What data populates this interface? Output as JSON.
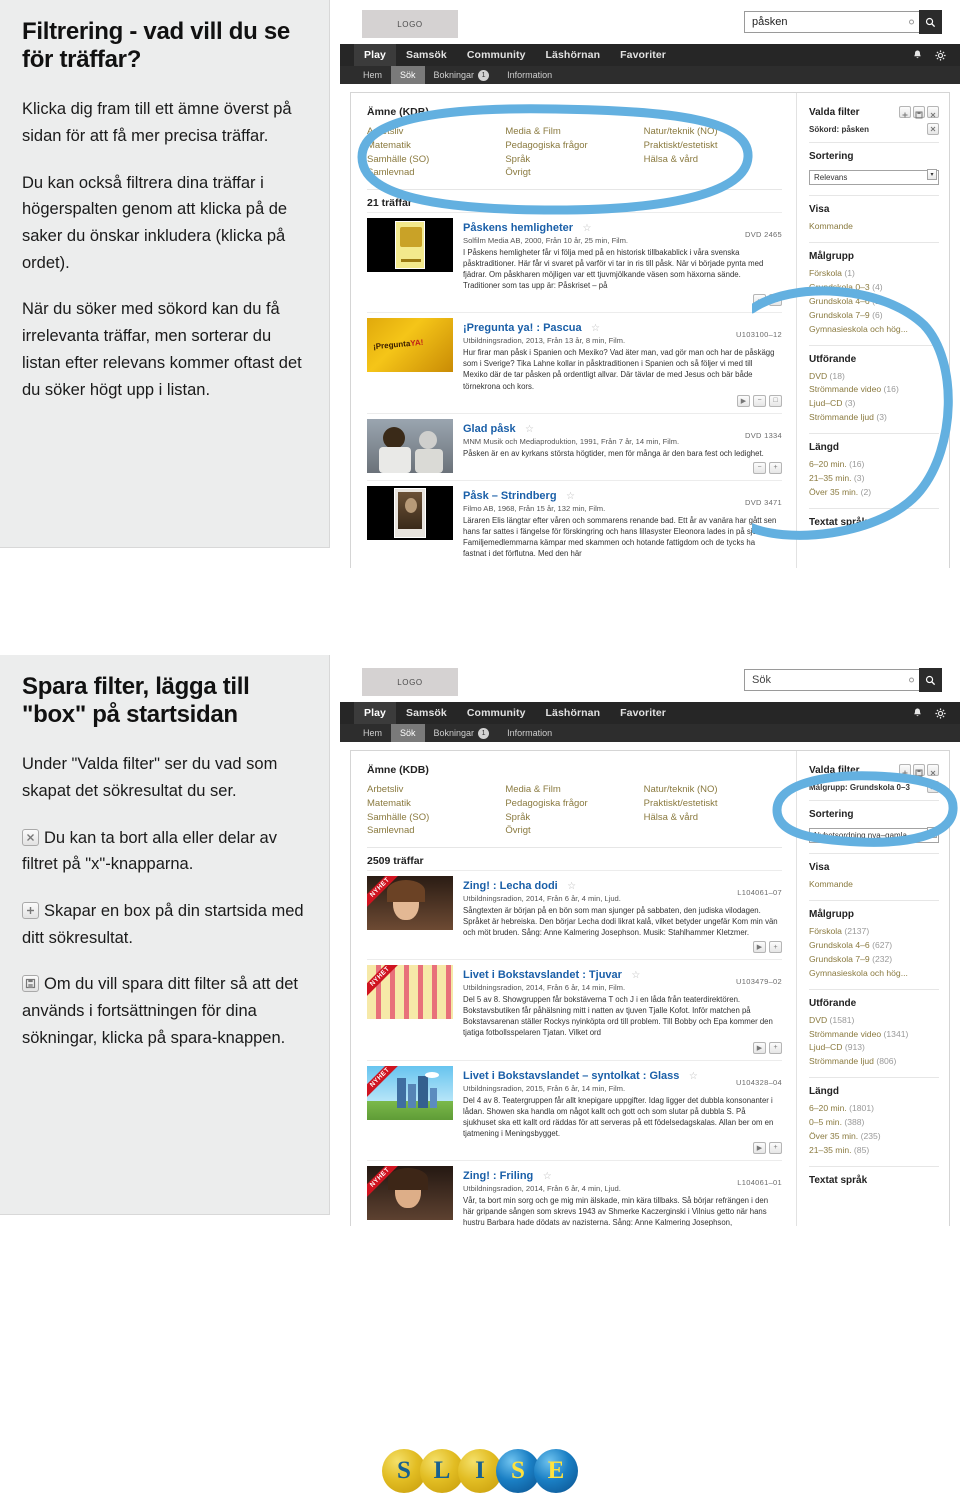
{
  "sections": [
    {
      "title": "Filtrering - vad vill du se för träffar?",
      "paragraphs": [
        "Klicka dig fram till ett ämne överst på sidan för att få mer precisa träffar.",
        "Du kan också filtrera dina träffar i högerspalten  genom att klicka på de saker du önskar inkludera (klicka på ordet).",
        "När du söker med sökord kan du få irrelevanta träffar, men sorterar du listan efter relevans kommer oftast det du söker högt upp i listan."
      ]
    },
    {
      "title": "Spara filter, lägga till \"box\" på startsidan",
      "paragraphs": [
        "Under \"Valda filter\" ser du vad som skapat det sökresultat du ser."
      ],
      "icon_paragraphs": [
        {
          "icon": "close-icon",
          "text": "Du kan ta bort alla eller delar av filtret på \"x\"-knapparna."
        },
        {
          "icon": "plus-icon",
          "text": "Skapar en box på din startsida med ditt sökresultat."
        },
        {
          "icon": "save-icon",
          "text": "Om du vill spara ditt filter så att det används i fortsättningen för dina sökningar, klicka på spara-knappen."
        }
      ]
    }
  ],
  "screenshots": [
    {
      "logo_label": "LOGO",
      "search_value": "påsken",
      "search_placeholder": "Sök",
      "search_icon": "search-icon",
      "nav_primary": [
        "Play",
        "Samsök",
        "Community",
        "Läshörnan",
        "Favoriter"
      ],
      "nav_primary_active": "Play",
      "nav_icons": [
        "bell-icon",
        "gear-icon"
      ],
      "nav_secondary": [
        {
          "label": "Hem",
          "badge": ""
        },
        {
          "label": "Sök",
          "badge": "",
          "active": true
        },
        {
          "label": "Bokningar",
          "badge": "1"
        },
        {
          "label": "Information",
          "badge": ""
        }
      ],
      "subject_heading": "Ämne (KDB)",
      "subject_columns": [
        [
          "Arbetsliv",
          "Matematik",
          "Samhälle (SO)",
          "Samlevnad"
        ],
        [
          "Media & Film",
          "Pedagogiska frågor",
          "Språk",
          "Övrigt"
        ],
        [
          "Natur/teknik (NO)",
          "Praktiskt/estetiskt",
          "Hälsa & vård"
        ]
      ],
      "hits_label": "21 träffar",
      "results": [
        {
          "title": "Påskens hemligheter",
          "meta": "Solfilm Media AB, 2000, Från 10 år, 25 min, Film.",
          "id": "DVD 2465",
          "desc": "I Påskens hemligheter får vi följa med på en historisk tillbakablick i våra svenska påsktraditioner. Här får vi svaret på varför vi tar in ris till påsk. När vi började pynta med fjädrar. Om påskharen möjligen var ett tjuvmjölkande väsen som häxorna sände. Traditioner som tas upp är: Påskriset – på",
          "thumb": "poster-yellow",
          "ribbon": "",
          "actions": [
            "minus-icon",
            "add-icon"
          ]
        },
        {
          "title": "¡Pregunta ya! : Pascua",
          "meta": "Utbildningsradion, 2013, Från 13 år, 8 min, Film.",
          "id": "U103100–12",
          "desc": "Hur firar man påsk i Spanien och Mexiko? Vad äter man, vad gör man och har de påskägg som i Sverige? Tika Lahne kollar in påsktraditionen i Spanien och så följer vi med till Mexiko där de tar påsken på ordentligt allvar. Där tävlar de med Jesus och bär både törnekrona och kors.",
          "thumb": "pregunta",
          "ribbon": "",
          "actions": [
            "play-icon",
            "minus-icon",
            "add-icon"
          ]
        },
        {
          "title": "Glad påsk",
          "meta": "MNM Musik och Mediaproduktion, 1991, Från 7 år, 14 min, Film.",
          "id": "DVD 1334",
          "desc": "Påsken är en av kyrkans största högtider, men för många är den bara fest och ledighet.",
          "thumb": "crowd",
          "ribbon": "",
          "actions": [
            "minus-icon",
            "add-icon"
          ]
        },
        {
          "title": "Påsk – Strindberg",
          "meta": "Filmo AB, 1968, Från 15 år, 132 min, Film.",
          "id": "DVD 3471",
          "desc": "Läraren Elis längtar efter våren och sommarens renande bad. Ett år av vanära har gått sen hans far sattes i fängelse för förskingring och hans lillasyster Eleonora lades in på sjukhus. Familjemedlemmarna kämpar med skammen och hotande fattigdom och de tycks ha fastnat i det förflutna. Med den här",
          "thumb": "portrait",
          "ribbon": "",
          "actions": []
        }
      ],
      "sidebar": {
        "filter_heading": "Valda filter",
        "filter_buttons": [
          "plus-icon",
          "save-icon",
          "close-icon"
        ],
        "active_filter": "Sökord: påsken",
        "active_filter_remove": "close-icon",
        "sort_heading": "Sortering",
        "sort_value": "Relevans",
        "sections": [
          {
            "heading": "Visa",
            "items": [
              {
                "label": "Kommande",
                "count": ""
              }
            ]
          },
          {
            "heading": "Målgrupp",
            "items": [
              {
                "label": "Förskola",
                "count": "(1)"
              },
              {
                "label": "Grundskola 0–3",
                "count": "(4)"
              },
              {
                "label": "Grundskola 4–6",
                "count": "(15)"
              },
              {
                "label": "Grundskola 7–9",
                "count": "(6)"
              },
              {
                "label": "Gymnasieskola och hög...",
                "count": ""
              }
            ]
          },
          {
            "heading": "Utförande",
            "items": [
              {
                "label": "DVD",
                "count": "(18)"
              },
              {
                "label": "Strömmande video",
                "count": "(16)"
              },
              {
                "label": "Ljud–CD",
                "count": "(3)"
              },
              {
                "label": "Strömmande ljud",
                "count": "(3)"
              }
            ]
          },
          {
            "heading": "Längd",
            "items": [
              {
                "label": "6–20 min.",
                "count": "(16)"
              },
              {
                "label": "21–35 min.",
                "count": "(3)"
              },
              {
                "label": "Över 35 min.",
                "count": "(2)"
              }
            ]
          },
          {
            "heading": "Textat språk",
            "items": []
          }
        ]
      }
    },
    {
      "logo_label": "LOGO",
      "search_value": "",
      "search_placeholder": "Sök",
      "search_icon": "search-icon",
      "nav_primary": [
        "Play",
        "Samsök",
        "Community",
        "Läshörnan",
        "Favoriter"
      ],
      "nav_primary_active": "Play",
      "nav_icons": [
        "bell-icon",
        "gear-icon"
      ],
      "nav_secondary": [
        {
          "label": "Hem",
          "badge": ""
        },
        {
          "label": "Sök",
          "badge": "",
          "active": true
        },
        {
          "label": "Bokningar",
          "badge": "1"
        },
        {
          "label": "Information",
          "badge": ""
        }
      ],
      "subject_heading": "Ämne (KDB)",
      "subject_columns": [
        [
          "Arbetsliv",
          "Matematik",
          "Samhälle (SO)",
          "Samlevnad"
        ],
        [
          "Media & Film",
          "Pedagogiska frågor",
          "Språk",
          "Övrigt"
        ],
        [
          "Natur/teknik (NO)",
          "Praktiskt/estetiskt",
          "Hälsa & vård"
        ]
      ],
      "hits_label": "2509 träffar",
      "results": [
        {
          "title": "Zing! : Lecha dodi",
          "meta": "Utbildningsradion, 2014, Från 6 år, 4 min, Ljud.",
          "id": "L104061–07",
          "desc": "Sångtexten är början på en bön som man sjunger på sabbaten, den judiska vilodagen. Språket är hebreiska. Den börjar Lecha dodi likrat kalå, vilket betyder ungefär Kom min vän och möt bruden. Sång: Anne Kalmering Josephson. Musik: Stahlhammer Kletzmer.",
          "thumb": "woman-violin",
          "ribbon": "NYHET",
          "actions": [
            "play-icon",
            "add-icon"
          ]
        },
        {
          "title": "Livet i Bokstavslandet : Tjuvar",
          "meta": "Utbildningsradion, 2014, Från 6 år, 14 min, Film.",
          "id": "U103479–02",
          "desc": "Del 5 av 8. Showgruppen får bokstäverna T och J i en låda från teaterdirektören. Bokstavsbutiken får påhälsning mitt i natten av tjuven Tjalle Kofot. Inför matchen på Bokstavsarenan ställer Rockys nyinköpta ord till problem. Till Bobby och Epa kommer den tjatiga fotbollsspelaren Tjatan. Vilket ord",
          "thumb": "balloon",
          "ribbon": "NYHET",
          "actions": [
            "play-icon",
            "add-icon"
          ]
        },
        {
          "title": "Livet i Bokstavslandet – syntolkat : Glass",
          "meta": "Utbildningsradion, 2015, Från 6 år, 14 min, Film.",
          "id": "U104328–04",
          "desc": "Del 4 av 8. Teatergruppen får allt knepigare uppgifter. Idag ligger det dubbla konsonanter i lådan. Showen ska handla om något kallt och gott och som slutar på dubbla S. På sjukhuset ska ett kallt ord räddas för att serveras på ett födelsedagskalas. Allan ber om en tjatmening i Meningsbygget.",
          "thumb": "city",
          "ribbon": "NYHET",
          "actions": [
            "play-icon",
            "add-icon"
          ]
        },
        {
          "title": "Zing! : Friling",
          "meta": "Utbildningsradion, 2014, Från 6 år, 4 min, Ljud.",
          "id": "L104061–01",
          "desc": "Vår, ta bort min sorg och ge mig min älskade, min kära tillbaks. Så börjar refrängen i den här gripande sången som skrevs 1943 av Shmerke Kaczerginski i Vilnius getto när hans hustru Barbara hade dödats av nazisterna. Sång: Anne Kalmering Josephson,",
          "thumb": "woman-cello",
          "ribbon": "NYHET",
          "actions": []
        }
      ],
      "sidebar": {
        "filter_heading": "Valda filter",
        "filter_buttons": [
          "plus-icon",
          "save-icon",
          "close-icon"
        ],
        "active_filter": "Målgrupp: Grundskola 0–3",
        "active_filter_remove": "close-icon",
        "sort_heading": "Sortering",
        "sort_value": "Nyhetsordning nya–gamla",
        "sections": [
          {
            "heading": "Visa",
            "items": [
              {
                "label": "Kommande",
                "count": ""
              }
            ]
          },
          {
            "heading": "Målgrupp",
            "items": [
              {
                "label": "Förskola",
                "count": "(2137)"
              },
              {
                "label": "Grundskola 4–6",
                "count": "(627)"
              },
              {
                "label": "Grundskola 7–9",
                "count": "(232)"
              },
              {
                "label": "Gymnasieskola och hög...",
                "count": ""
              }
            ]
          },
          {
            "heading": "Utförande",
            "items": [
              {
                "label": "DVD",
                "count": "(1581)"
              },
              {
                "label": "Strömmande video",
                "count": "(1341)"
              },
              {
                "label": "Ljud–CD",
                "count": "(913)"
              },
              {
                "label": "Strömmande ljud",
                "count": "(806)"
              }
            ]
          },
          {
            "heading": "Längd",
            "items": [
              {
                "label": "6–20 min.",
                "count": "(1801)"
              },
              {
                "label": "0–5 min.",
                "count": "(388)"
              },
              {
                "label": "Över 35 min.",
                "count": "(235)"
              },
              {
                "label": "21–35 min.",
                "count": "(85)"
              }
            ]
          },
          {
            "heading": "Textat språk",
            "items": []
          }
        ]
      }
    }
  ],
  "footer_logo": {
    "letters": [
      "S",
      "L",
      "I",
      "S",
      "E"
    ],
    "colors": [
      "gold",
      "gold",
      "gold",
      "blue",
      "blue"
    ]
  },
  "annotation_color": "#63b0e0"
}
